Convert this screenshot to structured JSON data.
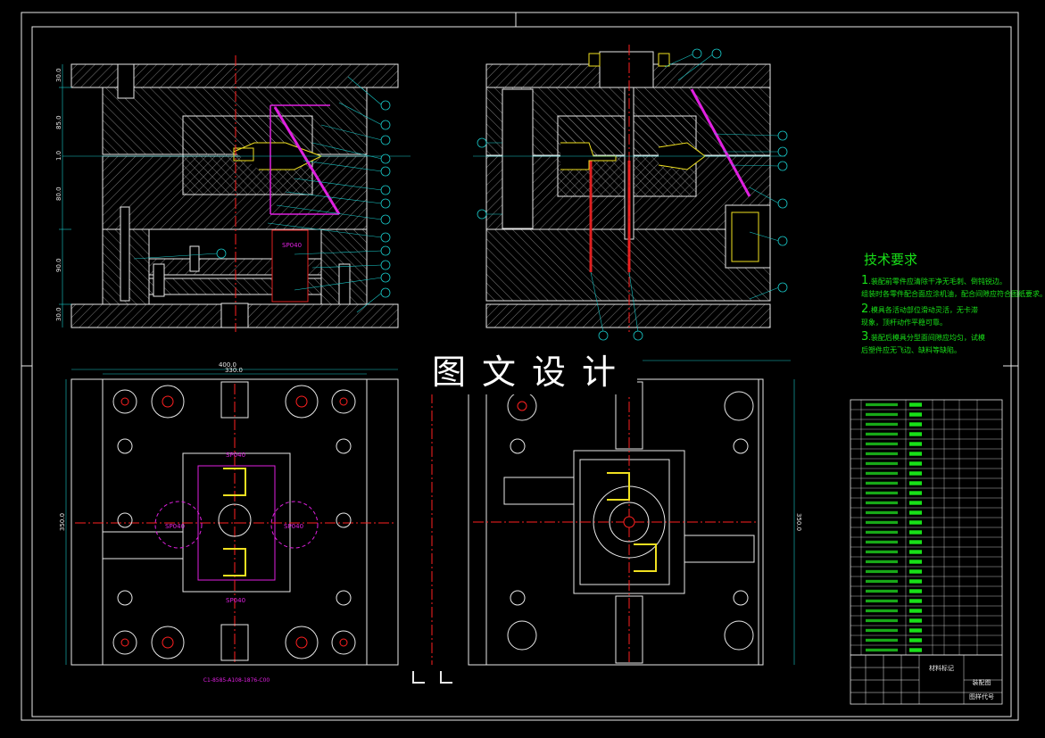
{
  "watermark": "图文设计",
  "tech_req": {
    "title": "技术要求",
    "items": [
      {
        "num": "1",
        "text": ".装配前零件应清除干净无毛刺、倒钝锐边。"
      },
      {
        "num": "",
        "text": "组装时各零件配合面应涂机油，配合间隙应符合图纸要求。"
      },
      {
        "num": "2",
        "text": ".模具各活动部位滑动灵活，无卡滞"
      },
      {
        "num": "",
        "text": "现象，顶杆动作平稳可靠。"
      },
      {
        "num": "3",
        "text": ".装配后模具分型面间隙应均匀，试模"
      },
      {
        "num": "",
        "text": "后塑件应无飞边、缺料等缺陷。"
      }
    ]
  },
  "dims": {
    "width_outer": "400.0",
    "width_inner": "330.0",
    "height_left": "350.0",
    "height_right": "350.0",
    "left_vertical": [
      "30.0",
      "85.0",
      "1.0",
      "80.0",
      "90.0",
      "30.0"
    ]
  },
  "labels": {
    "spring_label": "SP040",
    "bottom_note": "C1-8585-A108-1876-C00"
  },
  "title_block": {
    "material_label": "材料标记",
    "drawing_name": "装配图",
    "drawing_code": "图样代号"
  },
  "colors": {
    "background": "#000000",
    "outline": "#e8e8e8",
    "leader": "#18c8c8",
    "green": "#18e018",
    "red": "#ff2020",
    "magenta": "#e020e0",
    "yellow": "#f0e020"
  }
}
